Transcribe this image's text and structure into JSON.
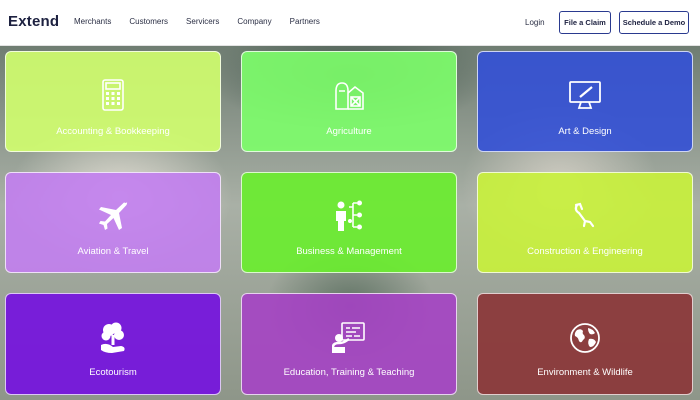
{
  "brand": {
    "logo": "Extend"
  },
  "nav": {
    "items": [
      "Merchants",
      "Customers",
      "Servicers",
      "Company",
      "Partners"
    ],
    "login": "Login",
    "file_claim": "File a Claim",
    "schedule_demo": "Schedule a Demo"
  },
  "categories": [
    {
      "label": "Accounting & Bookkeeping",
      "icon": "calculator-icon",
      "color": "#d2ff6e"
    },
    {
      "label": "Agriculture",
      "icon": "barn-icon",
      "color": "#7dff6a"
    },
    {
      "label": "Art & Design",
      "icon": "monitor-icon",
      "color": "#3350d6"
    },
    {
      "label": "Aviation & Travel",
      "icon": "airplane-icon",
      "color": "#c27ef0"
    },
    {
      "label": "Business & Management",
      "icon": "org-chart-icon",
      "color": "#69ee2c"
    },
    {
      "label": "Construction & Engineering",
      "icon": "tool-icon",
      "color": "#c9f23a"
    },
    {
      "label": "Ecotourism",
      "icon": "tree-hand-icon",
      "color": "#7410e0"
    },
    {
      "label": "Education, Training & Teaching",
      "icon": "teacher-board-icon",
      "color": "#a543c4"
    },
    {
      "label": "Environment & Wildlife",
      "icon": "globe-icon",
      "color": "#8b3436"
    }
  ]
}
